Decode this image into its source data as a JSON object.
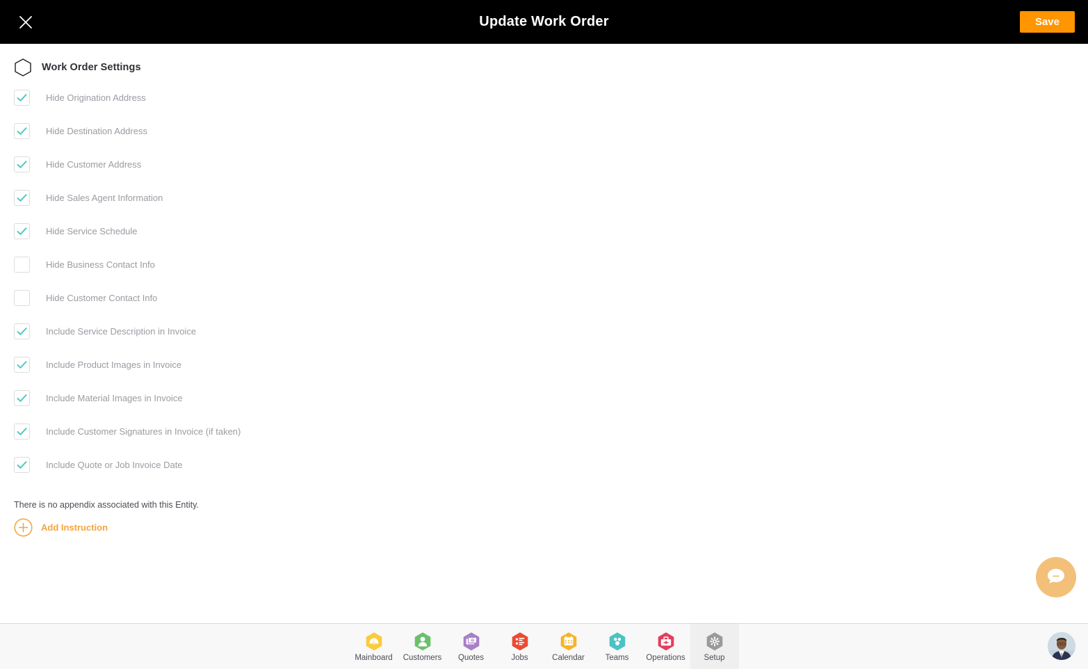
{
  "header": {
    "title": "Update Work Order",
    "close_icon": "close-icon",
    "save_label": "Save"
  },
  "section": {
    "icon": "hexagon-outline-icon",
    "title": "Work Order Settings"
  },
  "settings": {
    "items": [
      {
        "label": "Hide Origination Address",
        "checked": true
      },
      {
        "label": "Hide Destination Address",
        "checked": true
      },
      {
        "label": "Hide Customer Address",
        "checked": true
      },
      {
        "label": "Hide Sales Agent Information",
        "checked": true
      },
      {
        "label": "Hide Service Schedule",
        "checked": true
      },
      {
        "label": "Hide Business Contact Info",
        "checked": false
      },
      {
        "label": "Hide Customer Contact Info",
        "checked": false
      },
      {
        "label": "Include Service Description in Invoice",
        "checked": true
      },
      {
        "label": "Include Product Images in Invoice",
        "checked": true
      },
      {
        "label": "Include Material Images in Invoice",
        "checked": true
      },
      {
        "label": "Include Customer Signatures in Invoice (if taken)",
        "checked": true
      },
      {
        "label": "Include Quote or Job Invoice Date",
        "checked": true
      }
    ]
  },
  "appendix": {
    "note": "There is no appendix associated with this Entity.",
    "add_instruction_label": "Add Instruction",
    "add_instruction_icon": "plus-circle-icon"
  },
  "chat": {
    "icon": "chat-bubble-icon"
  },
  "footer": {
    "nav": [
      {
        "label": "Mainboard",
        "icon": "dashboard-icon",
        "color": "#FBCB3C",
        "active": false
      },
      {
        "label": "Customers",
        "icon": "person-icon",
        "color": "#6CC06C",
        "active": false
      },
      {
        "label": "Quotes",
        "icon": "money-icon",
        "color": "#A780C8",
        "active": false
      },
      {
        "label": "Jobs",
        "icon": "list-icon",
        "color": "#EA4B34",
        "active": false
      },
      {
        "label": "Calendar",
        "icon": "calendar-icon",
        "color": "#F5B429",
        "active": false
      },
      {
        "label": "Teams",
        "icon": "people-icon",
        "color": "#4BC3C3",
        "active": false
      },
      {
        "label": "Operations",
        "icon": "briefcase-icon",
        "color": "#E23E5C",
        "active": false
      },
      {
        "label": "Setup",
        "icon": "gear-icon",
        "color": "#9A9A9A",
        "active": true
      }
    ],
    "avatar_icon": "user-avatar"
  },
  "colors": {
    "accent_orange": "#FF9500",
    "check_teal": "#4FC9C0",
    "label_gray": "#9b9ba3",
    "topbar_black": "#000000"
  }
}
